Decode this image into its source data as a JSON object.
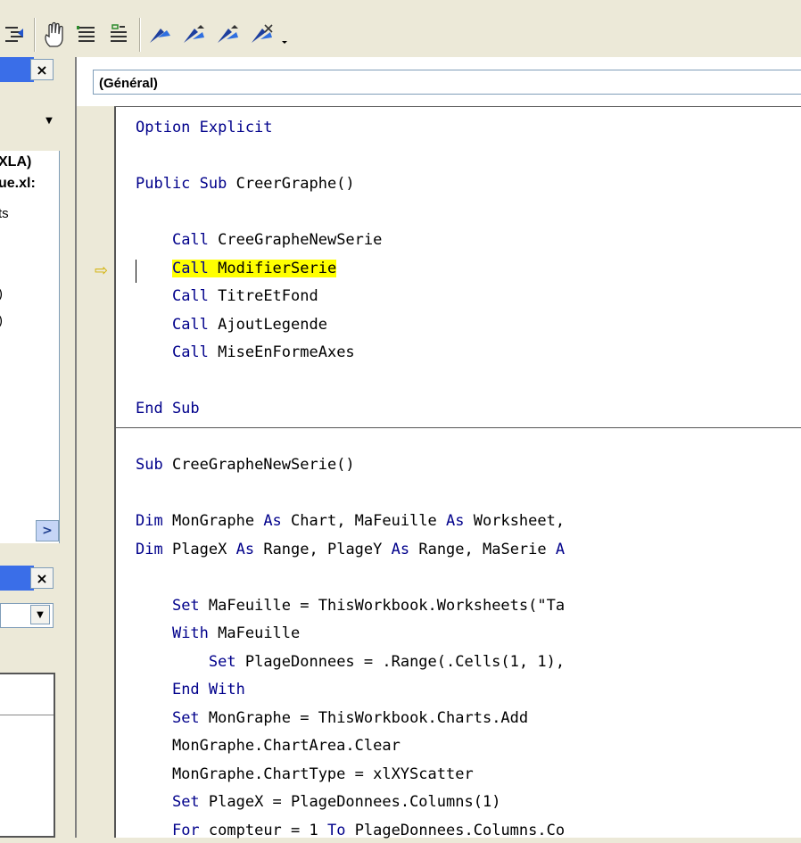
{
  "toolbar": {
    "icons": [
      "outdent-icon",
      "toggle-breakpoint-icon",
      "comment-block-icon",
      "uncomment-block-icon",
      "toggle-bookmark-icon",
      "next-bookmark-icon",
      "previous-bookmark-icon",
      "clear-bookmarks-icon",
      "dropdown-arrow-icon"
    ]
  },
  "left_panels": {
    "project_items": [
      "XLA)",
      "ue.xl:",
      "ts",
      ")",
      ")"
    ],
    "close_glyph": "×",
    "combo_arrow": "▼",
    "scroll_right_glyph": ">"
  },
  "code_window": {
    "object_combo": "(Général)",
    "breakpoint_arrow": "⇨",
    "lines": [
      {
        "segments": [
          {
            "t": "Option Explicit",
            "kw": true
          }
        ]
      },
      {
        "segments": []
      },
      {
        "segments": [
          {
            "t": "Public Sub",
            "kw": true
          },
          {
            "t": " CreerGraphe()",
            "kw": false
          }
        ]
      },
      {
        "segments": []
      },
      {
        "segments": [
          {
            "t": "    ",
            "kw": false
          },
          {
            "t": "Call",
            "kw": true
          },
          {
            "t": " CreeGrapheNewSerie",
            "kw": false
          }
        ]
      },
      {
        "segments": [
          {
            "t": "    ",
            "kw": false
          },
          {
            "t": "Call",
            "kw": true,
            "hl": true
          },
          {
            "t": " ModifierSerie",
            "kw": false,
            "hl": true
          }
        ]
      },
      {
        "segments": [
          {
            "t": "    ",
            "kw": false
          },
          {
            "t": "Call",
            "kw": true
          },
          {
            "t": " TitreEtFond",
            "kw": false
          }
        ]
      },
      {
        "segments": [
          {
            "t": "    ",
            "kw": false
          },
          {
            "t": "Call",
            "kw": true
          },
          {
            "t": " AjoutLegende",
            "kw": false
          }
        ]
      },
      {
        "segments": [
          {
            "t": "    ",
            "kw": false
          },
          {
            "t": "Call",
            "kw": true
          },
          {
            "t": " MiseEnFormeAxes",
            "kw": false
          }
        ]
      },
      {
        "segments": []
      },
      {
        "segments": [
          {
            "t": "End Sub",
            "kw": true
          }
        ]
      },
      {
        "segments": []
      },
      {
        "segments": [
          {
            "t": "Sub",
            "kw": true
          },
          {
            "t": " CreeGrapheNewSerie()",
            "kw": false
          }
        ]
      },
      {
        "segments": []
      },
      {
        "segments": [
          {
            "t": "Dim",
            "kw": true
          },
          {
            "t": " MonGraphe ",
            "kw": false
          },
          {
            "t": "As",
            "kw": true
          },
          {
            "t": " Chart, MaFeuille ",
            "kw": false
          },
          {
            "t": "As",
            "kw": true
          },
          {
            "t": " Worksheet,",
            "kw": false
          }
        ]
      },
      {
        "segments": [
          {
            "t": "Dim",
            "kw": true
          },
          {
            "t": " PlageX ",
            "kw": false
          },
          {
            "t": "As",
            "kw": true
          },
          {
            "t": " Range, PlageY ",
            "kw": false
          },
          {
            "t": "As",
            "kw": true
          },
          {
            "t": " Range, MaSerie ",
            "kw": false
          },
          {
            "t": "A",
            "kw": true
          }
        ]
      },
      {
        "segments": []
      },
      {
        "segments": [
          {
            "t": "    ",
            "kw": false
          },
          {
            "t": "Set",
            "kw": true
          },
          {
            "t": " MaFeuille = ThisWorkbook.Worksheets(\"Ta",
            "kw": false
          }
        ]
      },
      {
        "segments": [
          {
            "t": "    ",
            "kw": false
          },
          {
            "t": "With",
            "kw": true
          },
          {
            "t": " MaFeuille",
            "kw": false
          }
        ]
      },
      {
        "segments": [
          {
            "t": "        ",
            "kw": false
          },
          {
            "t": "Set",
            "kw": true
          },
          {
            "t": " PlageDonnees = .Range(.Cells(1, 1),",
            "kw": false
          }
        ]
      },
      {
        "segments": [
          {
            "t": "    ",
            "kw": false
          },
          {
            "t": "End With",
            "kw": true
          }
        ]
      },
      {
        "segments": [
          {
            "t": "    ",
            "kw": false
          },
          {
            "t": "Set",
            "kw": true
          },
          {
            "t": " MonGraphe = ThisWorkbook.Charts.Add",
            "kw": false
          }
        ]
      },
      {
        "segments": [
          {
            "t": "    MonGraphe.ChartArea.Clear",
            "kw": false
          }
        ]
      },
      {
        "segments": [
          {
            "t": "    MonGraphe.ChartType = xlXYScatter",
            "kw": false
          }
        ]
      },
      {
        "segments": [
          {
            "t": "    ",
            "kw": false
          },
          {
            "t": "Set",
            "kw": true
          },
          {
            "t": " PlageX = PlageDonnees.Columns(1)",
            "kw": false
          }
        ]
      },
      {
        "segments": [
          {
            "t": "    ",
            "kw": false
          },
          {
            "t": "For",
            "kw": true
          },
          {
            "t": " compteur = 1 ",
            "kw": false
          },
          {
            "t": "To",
            "kw": true
          },
          {
            "t": " PlageDonnees.Columns.Co",
            "kw": false
          }
        ]
      }
    ]
  }
}
